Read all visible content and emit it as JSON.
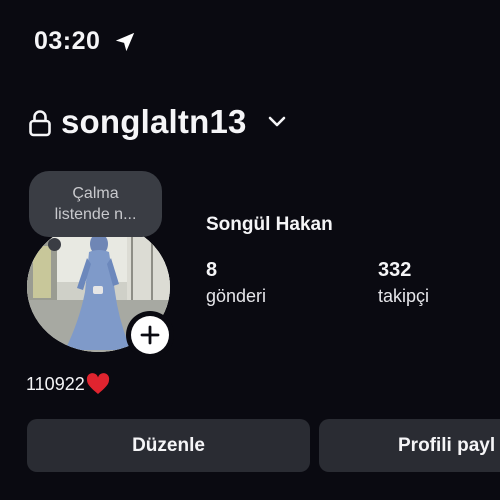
{
  "status_bar": {
    "time": "03:20"
  },
  "header": {
    "username": "songlaltn13"
  },
  "note": {
    "line1": "Çalma",
    "line2": "listende n..."
  },
  "profile": {
    "display_name": "Songül Hakan",
    "posts": {
      "value": "8",
      "label": "gönderi"
    },
    "followers": {
      "value": "332",
      "label": "takipçi"
    },
    "bio": "110922"
  },
  "actions": {
    "edit_label": "Düzenle",
    "share_label": "Profili payl"
  },
  "colors": {
    "background": "#0a0a11",
    "button": "#2a2c33",
    "bubble": "#3a3d44",
    "heart": "#e0242f"
  }
}
